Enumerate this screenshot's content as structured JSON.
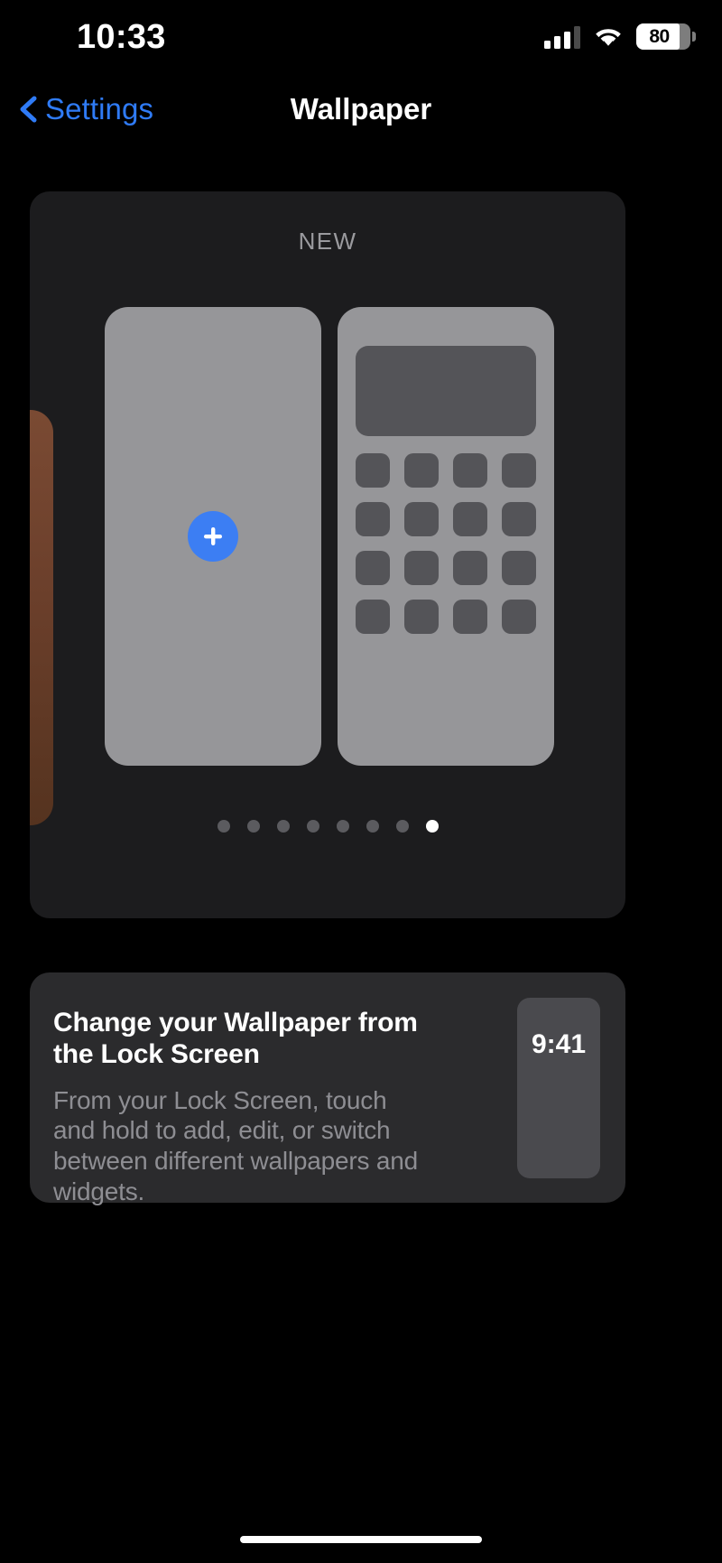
{
  "status_bar": {
    "time": "10:33",
    "battery_percent": "80",
    "battery_level": 80,
    "cellular_icon": "cellular-bars-icon",
    "wifi_icon": "wifi-icon",
    "battery_icon": "battery-icon"
  },
  "nav": {
    "back_label": "Settings",
    "back_icon": "chevron-left-icon",
    "title": "Wallpaper"
  },
  "gallery": {
    "section_label": "NEW",
    "add_button_icon": "plus-icon",
    "thumbnails": [
      {
        "name": "add-new-wallpaper",
        "type": "add"
      },
      {
        "name": "calculator-wallpaper",
        "type": "calculator"
      }
    ],
    "page_dots": {
      "total": 8,
      "active_index": 7
    }
  },
  "info_card": {
    "title": "Change your Wallpaper from the Lock Screen",
    "body": "From your Lock Screen, touch and hold to add, edit, or switch between different wallpapers and widgets.",
    "preview_time": "9:41"
  },
  "colors": {
    "background": "#000000",
    "card": "#1c1c1e",
    "info_card": "#2b2b2d",
    "accent_blue": "#3c7ef3",
    "link_blue": "#2f7bf6",
    "thumbnail_gray": "#969699",
    "key_gray": "#545458",
    "muted_text": "#8e8e93"
  }
}
